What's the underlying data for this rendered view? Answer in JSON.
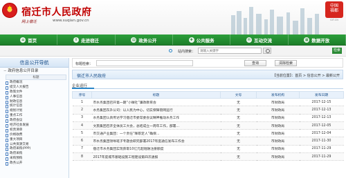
{
  "header": {
    "site_title": "宿迁市人民政府",
    "slogan": "网上宿迁",
    "url": "www.suqian.gov.cn",
    "seal_text": "中国福都",
    "seal_sub": "GIT.CN"
  },
  "nav": [
    {
      "label": "首页",
      "icon": "home-icon"
    },
    {
      "label": "走进宿迁",
      "icon": "info-icon"
    },
    {
      "label": "政务公开",
      "icon": "document-icon"
    },
    {
      "label": "公共服务",
      "icon": "service-icon"
    },
    {
      "label": "互动交流",
      "icon": "chat-icon"
    },
    {
      "label": "数据开放",
      "icon": "data-icon"
    }
  ],
  "search": {
    "label": "站内搜索：",
    "placeholder": "请输入关键字",
    "advanced_label": "检索"
  },
  "sidebar": {
    "title": "信息公开导航",
    "root_label": "政府信息公开目录",
    "sub_header": "标题",
    "items": [
      "政府概况",
      "提交人大报告",
      "政策文件",
      "人事信息",
      "财政信息",
      "统计信息",
      "规划计划",
      "重点工作",
      "政府会议",
      "经济社会发展",
      "权责清单",
      "价格收费",
      "重大项目",
      "公共资源交易",
      "政府采购(PPP)",
      "政府采购",
      "采购预购",
      "政务公开"
    ]
  },
  "criteria": {
    "label": "标题检索：",
    "search_button": "查询",
    "reset_button": "清除检索"
  },
  "crumb": {
    "org": "宿迁市人民政府",
    "position": "【当前位置】：首页 > 信息公开 > 最新公开"
  },
  "category_title": "企业运行",
  "table": {
    "headers": [
      "序号",
      "标题",
      "文号",
      "发布机构",
      "发布日期"
    ],
    "rows": [
      [
        "1",
        "市水务集团召开第一期“小微社”廉政教育会",
        "无",
        "市财政局",
        "2017-12-15"
      ],
      [
        "2",
        "水务集团东升公司：以人民为中心，切实保障管网运行",
        "无",
        "市财政局",
        "2017-12-13"
      ],
      [
        "3",
        "水务集团认真传达学习宿迁市委常委会议精神推动水务工作",
        "无",
        "市财政局",
        "2017-12-13"
      ],
      [
        "4",
        "文旅集团召开全体员工大会，总结成立一周年工作，部署...",
        "无",
        "市财政局",
        "2017-12-05"
      ],
      [
        "5",
        "市交通产业集团：一个责任“降职定人”确保...",
        "无",
        "市财政局",
        "2017-12-04"
      ],
      [
        "6",
        "市水务集团领导班子专题会研究部署2017年度通信发布工作会",
        "无",
        "市财政局",
        "2017-11-30"
      ],
      [
        "7",
        "宿迁市水务集团实现获取10亿元超短融注册额度",
        "无",
        "市财政局",
        "2017-11-29"
      ],
      [
        "8",
        "2017年度城市基础设施工程建设第四次通报",
        "无",
        "市财政局",
        "2017-11-29"
      ]
    ]
  },
  "colors": {
    "brand_red": "#c10000",
    "nav_green": "#1d7f2a",
    "link_blue": "#1a4f8a"
  }
}
